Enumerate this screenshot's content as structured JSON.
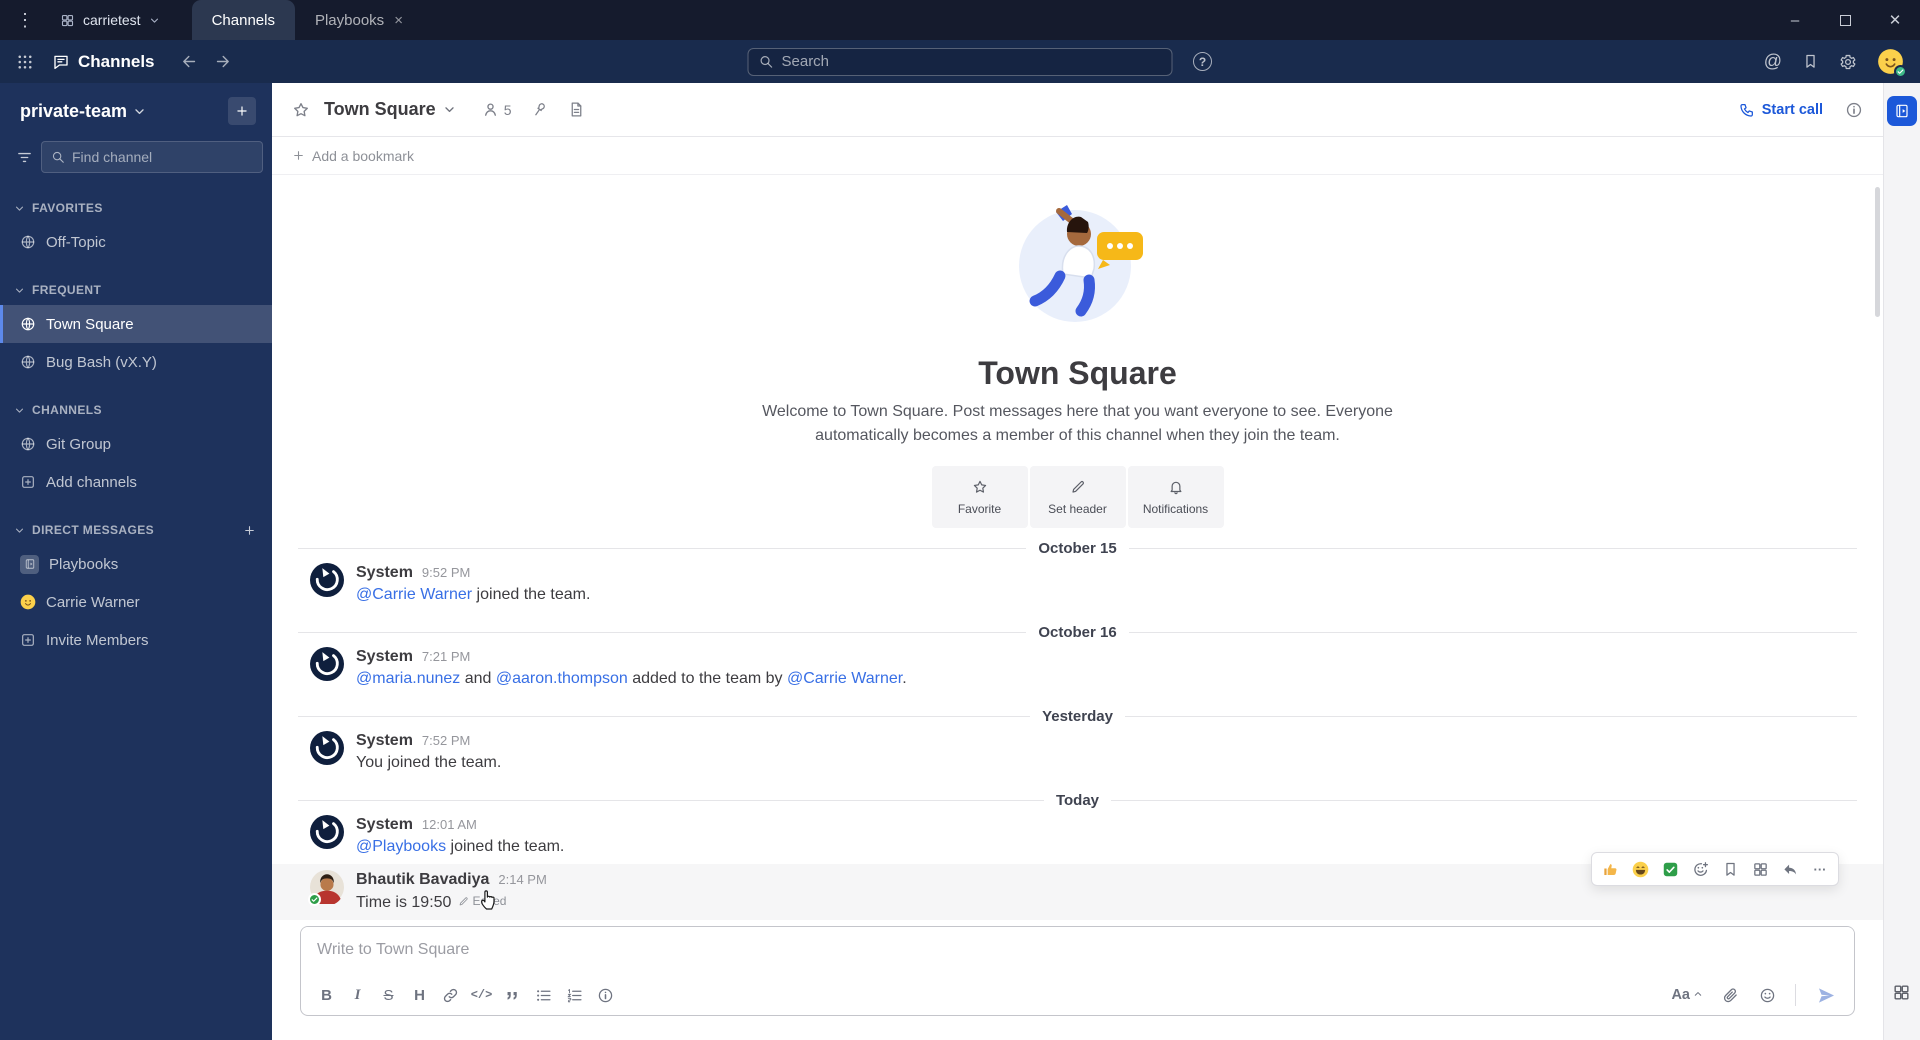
{
  "app": {
    "server_name": "carrietest",
    "tabs": [
      {
        "label": "Channels",
        "active": true
      },
      {
        "label": "Playbooks",
        "active": false
      }
    ]
  },
  "global_header": {
    "product_name": "Channels",
    "search_placeholder": "Search"
  },
  "sidebar": {
    "team_name": "private-team",
    "find_channel_placeholder": "Find channel",
    "sections": {
      "favorites": {
        "label": "FAVORITES",
        "items": [
          {
            "label": "Off-Topic",
            "icon": "globe-icon"
          }
        ]
      },
      "frequent": {
        "label": "FREQUENT",
        "items": [
          {
            "label": "Town Square",
            "icon": "globe-icon",
            "selected": true
          },
          {
            "label": "Bug Bash (vX.Y)",
            "icon": "globe-icon"
          }
        ]
      },
      "channels": {
        "label": "CHANNELS",
        "items": [
          {
            "label": "Git Group",
            "icon": "globe-icon"
          },
          {
            "label": "Add channels",
            "icon": "plus-box-icon"
          }
        ]
      },
      "dms": {
        "label": "DIRECT MESSAGES",
        "items": [
          {
            "label": "Playbooks",
            "icon": "playbooks-icon"
          },
          {
            "label": "Carrie Warner",
            "icon": "yellow-avatar"
          },
          {
            "label": "Invite Members",
            "icon": "plus-box-icon"
          }
        ]
      }
    }
  },
  "channel": {
    "name": "Town Square",
    "member_count": "5",
    "start_call_label": "Start call",
    "add_bookmark_label": "Add a bookmark"
  },
  "intro": {
    "title": "Town Square",
    "description": "Welcome to Town Square. Post messages here that you want everyone to see. Everyone automatically becomes a member of this channel when they join the team.",
    "actions": [
      {
        "label": "Favorite",
        "icon": "star-icon"
      },
      {
        "label": "Set header",
        "icon": "pencil-icon"
      },
      {
        "label": "Notifications",
        "icon": "bell-icon"
      }
    ]
  },
  "timeline": {
    "divider1": "October 15",
    "msg1": {
      "sender": "System",
      "time": "9:52 PM",
      "link1": "@Carrie Warner",
      "text1": " joined the team."
    },
    "divider2": "October 16",
    "msg2": {
      "sender": "System",
      "time": "7:21 PM",
      "link1": "@maria.nunez",
      "text1": " and ",
      "link2": "@aaron.thompson",
      "text2": " added to the team by ",
      "link3": "@Carrie Warner",
      "text3": "."
    },
    "divider3": "Yesterday",
    "msg3": {
      "sender": "System",
      "time": "7:52 PM",
      "text1": "You joined the team."
    },
    "divider4": "Today",
    "msg4": {
      "sender": "System",
      "time": "12:01 AM",
      "link1": "@Playbooks",
      "text1": " joined the team."
    },
    "msg5": {
      "sender": "Bhautik Bavadiya",
      "time": "2:14 PM",
      "text": "Time is 19:50",
      "edited_label": "Edited"
    }
  },
  "hover_toolbar": {
    "quick_reactions": [
      "thumbsup-emoji",
      "laughing-emoji",
      "white-check-mark-emoji"
    ],
    "icons": [
      "add-reaction-icon",
      "save-message-icon",
      "message-actions-icon",
      "reply-icon",
      "more-actions-icon"
    ]
  },
  "composer": {
    "placeholder": "Write to Town Square"
  },
  "icons": {
    "kebab": "⋮",
    "at_sign": "@",
    "question": "?",
    "bold": "B",
    "italic": "I",
    "strike": "S",
    "heading": "H",
    "code": "</>",
    "aa": "Aa",
    "more": "···",
    "minimize": "–",
    "close": "✕",
    "tab_close": "×"
  },
  "colors": {
    "titlebar_bg": "#151b2d",
    "header_bg": "#192b4d",
    "sidebar_bg": "#1e325c",
    "selected_accent": "#5d89ea",
    "link_blue": "#386fe5",
    "call_blue": "#1c58d9"
  }
}
